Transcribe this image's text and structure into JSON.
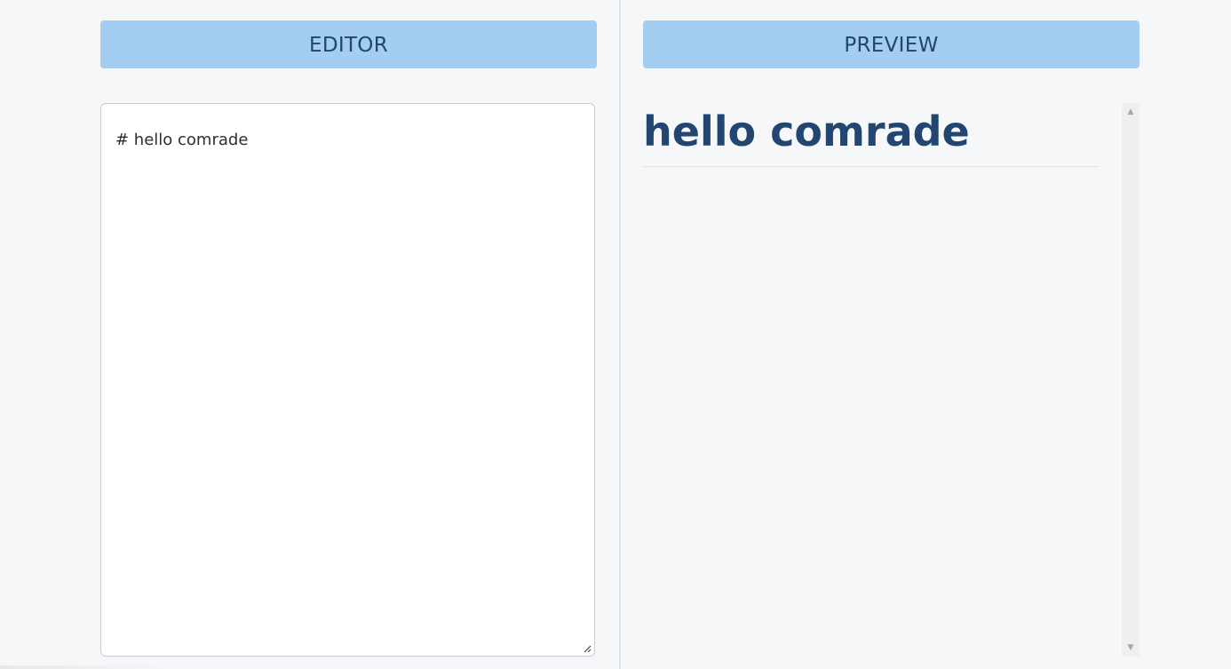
{
  "editor": {
    "header_label": "EDITOR",
    "content": "# hello comrade"
  },
  "preview": {
    "header_label": "PREVIEW",
    "heading": "hello comrade"
  },
  "scrollbar": {
    "up_icon": "triangle-up-icon",
    "down_icon": "triangle-down-icon"
  },
  "colors": {
    "header_bg": "#a3cdf1",
    "header_text": "#22466f",
    "page_bg": "#f5f7f9"
  }
}
